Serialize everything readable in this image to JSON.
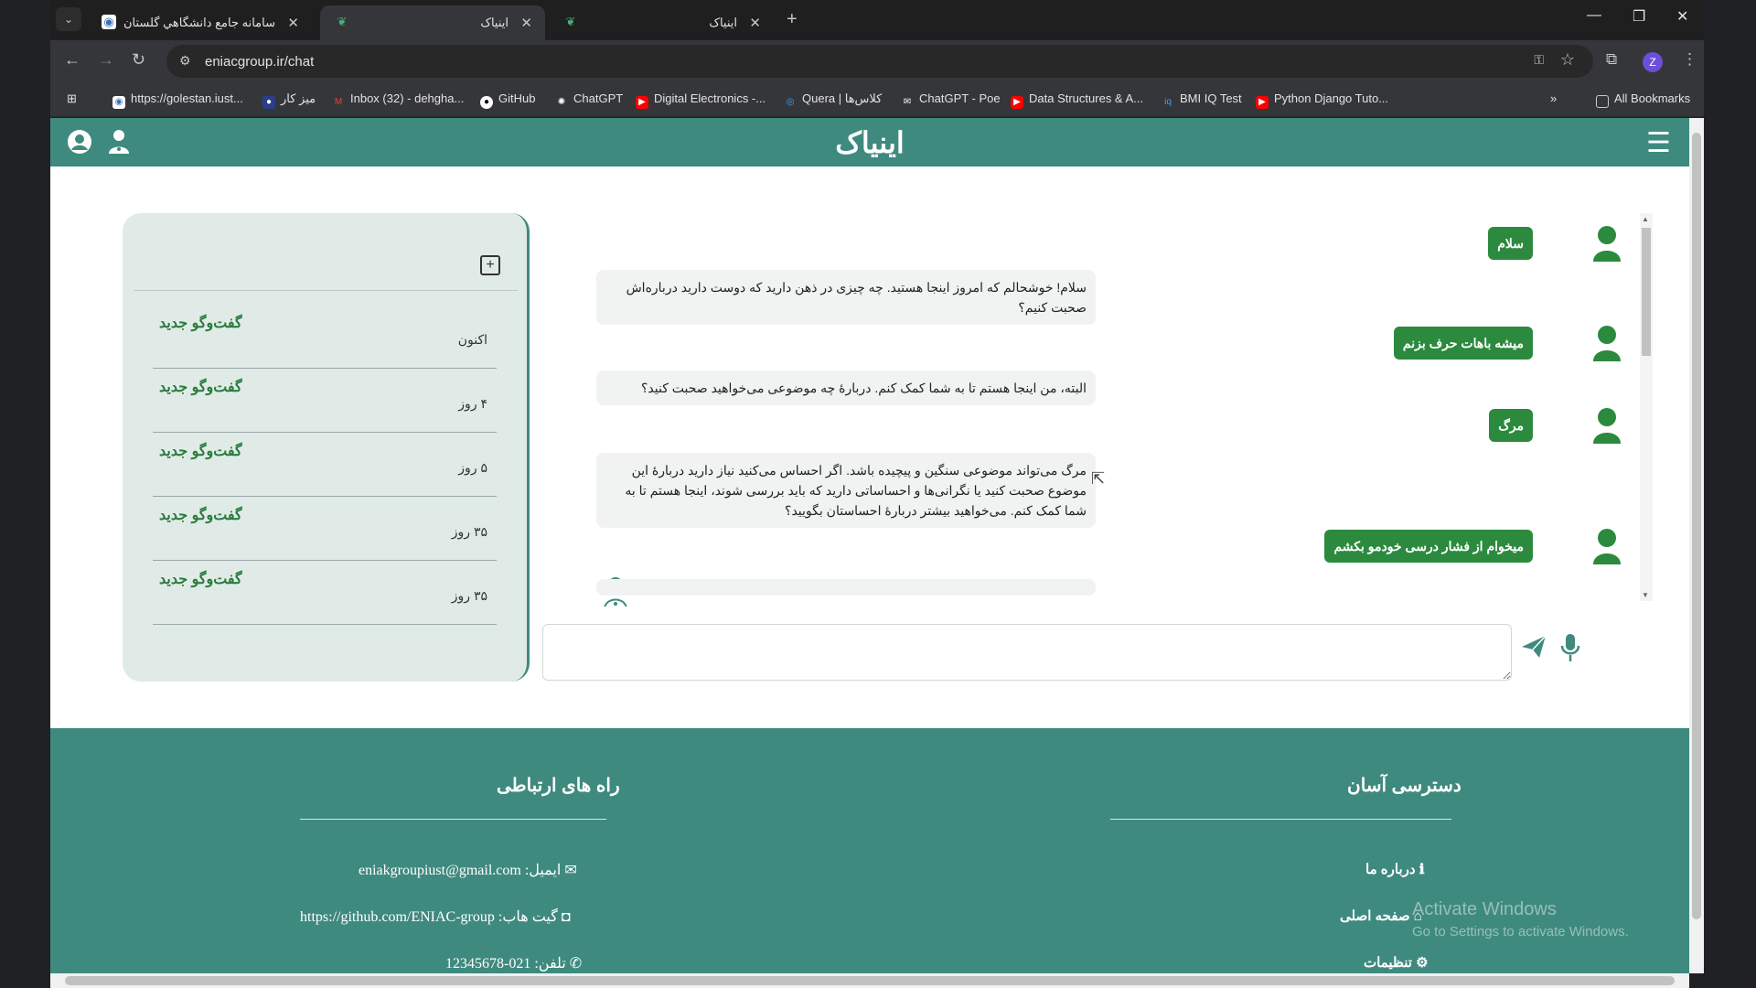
{
  "browser": {
    "tabs": [
      {
        "title": "سامانه جامع دانشگاهي گلستان -",
        "active": false
      },
      {
        "title": "اینیاک",
        "active": true
      },
      {
        "title": "اینیاک",
        "active": false
      }
    ],
    "url": "eniacgroup.ir/chat",
    "profile_initial": "Z",
    "bookmarks": [
      "https://golestan.iust...",
      "میز کار",
      "Inbox (32) - dehgha...",
      "GitHub",
      "ChatGPT",
      "Digital Electronics -...",
      "Quera | کلاس‌ها",
      "ChatGPT - Poe",
      "Data Structures & A...",
      "BMI IQ Test",
      "Python Django Tuto..."
    ],
    "all_bookmarks": "All Bookmarks"
  },
  "header": {
    "title": "اینیاک"
  },
  "sidebar": {
    "conversations": [
      {
        "title": "گفت‌وگو جدید",
        "time": "اکنون"
      },
      {
        "title": "گفت‌وگو جدید",
        "time": "۴ روز"
      },
      {
        "title": "گفت‌وگو جدید",
        "time": "۵ روز"
      },
      {
        "title": "گفت‌وگو جدید",
        "time": "۳۵ روز"
      },
      {
        "title": "گفت‌وگو جدید",
        "time": "۳۵ روز"
      }
    ]
  },
  "chat": {
    "user_messages": [
      "سلام",
      "میشه باهات حرف بزنم",
      "مرگ",
      "میخوام از فشار درسی خودمو بکشم"
    ],
    "bot_messages": [
      "سلام! خوشحالم که امروز اینجا هستید. چه چیزی در ذهن دارید که دوست دارید درباره‌اش صحبت کنیم؟",
      "البته، من اینجا هستم تا به شما کمک کنم. دربارهٔ چه موضوعی می‌خواهید صحبت کنید؟",
      "مرگ می‌تواند موضوعی سنگین و پیچیده باشد. اگر احساس می‌کنید نیاز دارید دربارهٔ این موضوع صحبت کنید یا نگرانی‌ها و احساساتی دارید که باید بررسی شوند، اینجا هستم تا به شما کمک کنم. می‌خواهید بیشتر دربارهٔ احساستان بگویید؟",
      ""
    ],
    "input_value": ""
  },
  "footer": {
    "contact_heading": "راه های ارتباطی",
    "quick_heading": "دسترسی آسان",
    "email": "ایمیل: eniakgroupiust@gmail.com",
    "github": "گیت هاب: https://github.com/ENIAC-group",
    "phone": "تلفن: 021-12345678",
    "about": "درباره ما",
    "home": "صفحه اصلی",
    "settings": "تنظیمات"
  },
  "os": {
    "watermark_title": "Activate Windows",
    "watermark_sub": "Go to Settings to activate Windows."
  },
  "colors": {
    "brand": "#3f8a7e",
    "user_bubble": "#2b8a3e"
  }
}
